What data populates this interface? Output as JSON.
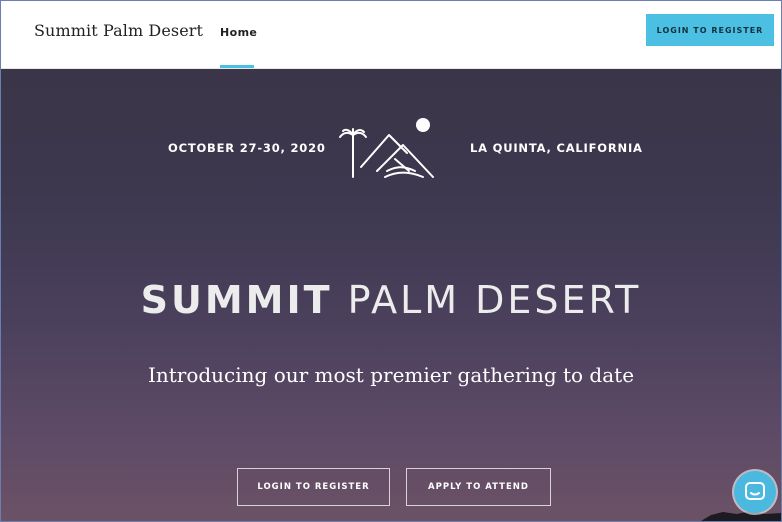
{
  "header": {
    "brand": "Summit Palm Desert",
    "nav": [
      {
        "label": "Home",
        "active": true
      }
    ],
    "cta_label": "LOGIN TO REGISTER"
  },
  "hero": {
    "date": "OCTOBER 27-30, 2020",
    "location": "LA QUINTA, CALIFORNIA",
    "logo_icon": "palm-mountain-sun-logo",
    "title_bold": "SUMMIT",
    "title_light": "PALM DESERT",
    "subtitle": "Introducing our most premier gathering to date",
    "buttons": {
      "login": "LOGIN TO REGISTER",
      "apply": "APPLY TO ATTEND"
    }
  },
  "chat": {
    "icon": "chat-icon"
  },
  "colors": {
    "accent": "#4bc0e3",
    "hero_top": "#3a3547",
    "hero_bottom": "#6b5266"
  }
}
